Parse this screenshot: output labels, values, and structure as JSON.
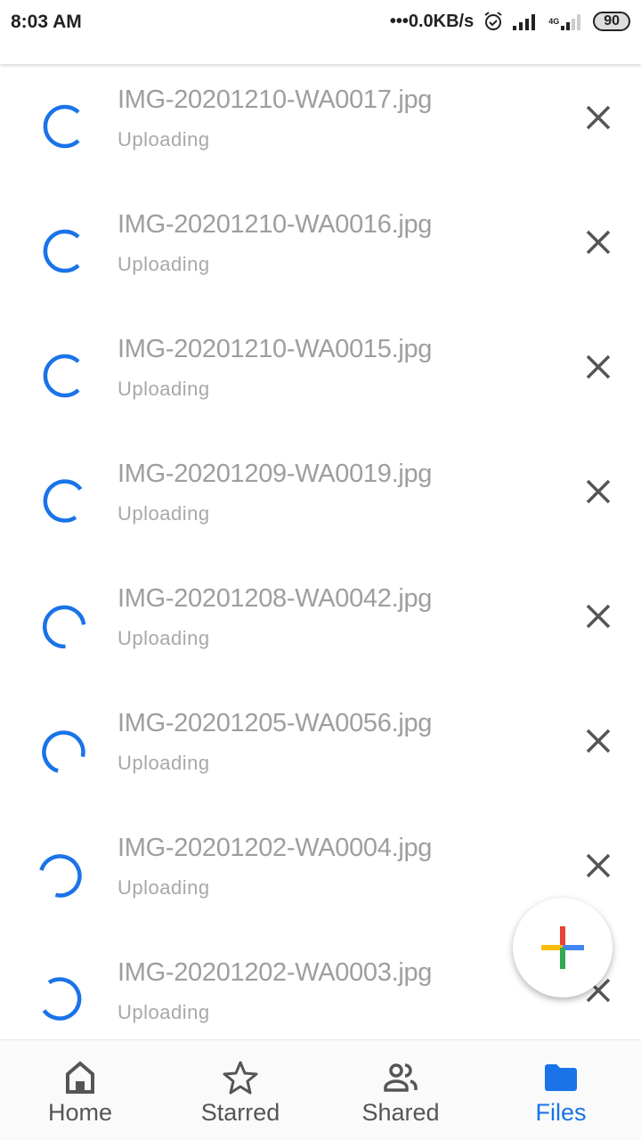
{
  "status_bar": {
    "time": "8:03 AM",
    "network_speed": "•••0.0KB/s",
    "network_type": "4G",
    "battery": "90"
  },
  "uploads": [
    {
      "filename": "IMG-20201210-WA0017.jpg",
      "status": "Uploading"
    },
    {
      "filename": "IMG-20201210-WA0016.jpg",
      "status": "Uploading"
    },
    {
      "filename": "IMG-20201210-WA0015.jpg",
      "status": "Uploading"
    },
    {
      "filename": "IMG-20201209-WA0019.jpg",
      "status": "Uploading"
    },
    {
      "filename": "IMG-20201208-WA0042.jpg",
      "status": "Uploading"
    },
    {
      "filename": "IMG-20201205-WA0056.jpg",
      "status": "Uploading"
    },
    {
      "filename": "IMG-20201202-WA0004.jpg",
      "status": "Uploading"
    },
    {
      "filename": "IMG-20201202-WA0003.jpg",
      "status": "Uploading"
    }
  ],
  "nav": [
    {
      "label": "Home",
      "icon": "home-icon"
    },
    {
      "label": "Starred",
      "icon": "star-icon"
    },
    {
      "label": "Shared",
      "icon": "shared-icon"
    },
    {
      "label": "Files",
      "icon": "folder-icon",
      "active": true
    }
  ],
  "colors": {
    "accent": "#1a73e8",
    "text_muted": "#9e9e9e"
  }
}
